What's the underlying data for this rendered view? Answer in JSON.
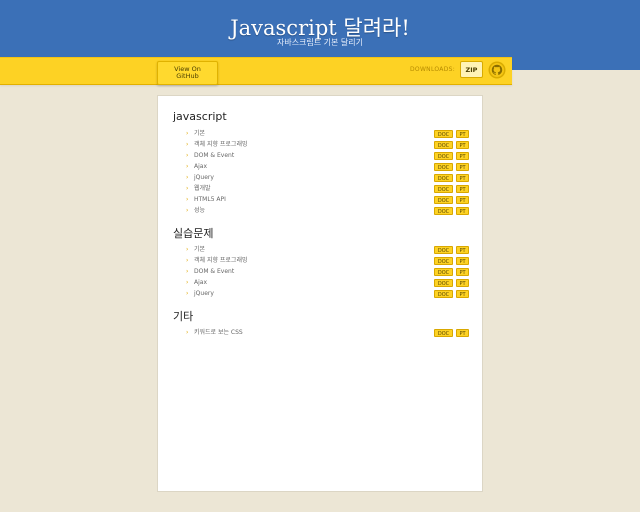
{
  "header": {
    "title": "Javascript 달려라!",
    "subtitle": "자바스크립트 기본 달리기"
  },
  "toolbar": {
    "view_on_github_line1": "View On",
    "view_on_github_line2": "GitHub",
    "downloads_label": "DOWNLOADS:",
    "zip_label": "ZIP"
  },
  "colors": {
    "header_bg": "#3b70b7",
    "bar_bg": "#fdd224",
    "page_bg": "#ece6d5"
  },
  "sections": [
    {
      "title": "javascript",
      "items": [
        {
          "label": "기본",
          "doc": "DOC",
          "pt": "PT"
        },
        {
          "label": "객체 지향 프로그래밍",
          "doc": "DOC",
          "pt": "PT"
        },
        {
          "label": "DOM & Event",
          "doc": "DOC",
          "pt": "PT"
        },
        {
          "label": "Ajax",
          "doc": "DOC",
          "pt": "PT"
        },
        {
          "label": "jQuery",
          "doc": "DOC",
          "pt": "PT"
        },
        {
          "label": "웹개발",
          "doc": "DOC",
          "pt": "PT"
        },
        {
          "label": "HTML5 API",
          "doc": "DOC",
          "pt": "PT"
        },
        {
          "label": "성능",
          "doc": "DOC",
          "pt": "PT"
        }
      ]
    },
    {
      "title": "실습문제",
      "items": [
        {
          "label": "기본",
          "doc": "DOC",
          "pt": "PT"
        },
        {
          "label": "객체 지향 프로그래밍",
          "doc": "DOC",
          "pt": "PT"
        },
        {
          "label": "DOM & Event",
          "doc": "DOC",
          "pt": "PT"
        },
        {
          "label": "Ajax",
          "doc": "DOC",
          "pt": "PT"
        },
        {
          "label": "jQuery",
          "doc": "DOC",
          "pt": "PT"
        }
      ]
    },
    {
      "title": "기타",
      "items": [
        {
          "label": "키워드로 보는 CSS",
          "doc": "DOC",
          "pt": "PT"
        }
      ]
    }
  ]
}
